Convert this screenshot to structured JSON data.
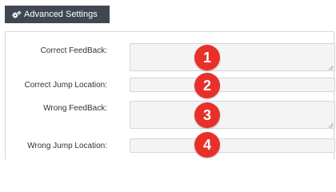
{
  "tab": {
    "label": "Advanced Settings",
    "icon": "gears-icon"
  },
  "fields": [
    {
      "label": "Correct FeedBack:",
      "value": "",
      "badge": "1"
    },
    {
      "label": "Correct Jump Location:",
      "value": "",
      "badge": "2"
    },
    {
      "label": "Wrong FeedBack:",
      "value": "",
      "badge": "3"
    },
    {
      "label": "Wrong Jump Location:",
      "value": "",
      "badge": "4"
    }
  ],
  "colors": {
    "tab_background": "#3f4852",
    "badge": "#e8302a",
    "field_background": "#f4f4f4"
  }
}
